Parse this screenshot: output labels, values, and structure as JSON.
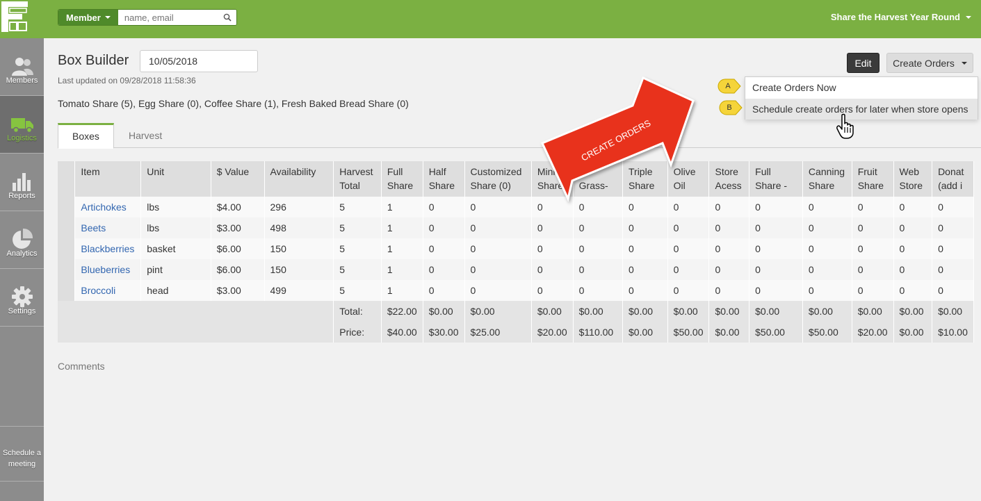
{
  "header": {
    "member_label": "Member",
    "search_placeholder": "name, email",
    "org_name": "Share the Harvest Year Round"
  },
  "sidebar": {
    "items": [
      {
        "label": "Members",
        "icon": "members-icon"
      },
      {
        "label": "Logistics",
        "icon": "truck-icon"
      },
      {
        "label": "Reports",
        "icon": "bar-chart-icon"
      },
      {
        "label": "Analytics",
        "icon": "pie-chart-icon"
      },
      {
        "label": "Settings",
        "icon": "gear-icon"
      }
    ],
    "schedule": "Schedule a meeting"
  },
  "page": {
    "title": "Box Builder",
    "date": "10/05/2018",
    "last_updated": "Last updated on 09/28/2018 11:58:36",
    "shares_text": "Tomato Share (5), Egg Share (0), Coffee Share (1), Fresh Baked Bread Share (0)",
    "edit_label": "Edit",
    "create_orders_label": "Create Orders",
    "comments_label": "Comments"
  },
  "dropdown": {
    "items": [
      "Create Orders Now",
      "Schedule create orders for later when store opens"
    ],
    "markers": [
      "A",
      "B"
    ]
  },
  "annotation": {
    "arrow_text": "CREATE ORDERS"
  },
  "tabs": [
    "Boxes",
    "Harvest"
  ],
  "table": {
    "columns": [
      "Item",
      "Unit",
      "$ Value",
      "Availability",
      "Harvest Total",
      "Full Share",
      "Half Share",
      "Customized Share (0)",
      "Mini Share",
      "Grass-",
      "Triple Share",
      "Olive Oil",
      "Store Acess",
      "Full Share -",
      "Canning Share",
      "Fruit Share",
      "Web Store",
      "Donat (add i"
    ],
    "rows": [
      [
        "Artichokes",
        "lbs",
        "$4.00",
        "296",
        "5",
        "1",
        "0",
        "0",
        "0",
        "0",
        "0",
        "0",
        "0",
        "0",
        "0",
        "0",
        "0",
        "0"
      ],
      [
        "Beets",
        "lbs",
        "$3.00",
        "498",
        "5",
        "1",
        "0",
        "0",
        "0",
        "0",
        "0",
        "0",
        "0",
        "0",
        "0",
        "0",
        "0",
        "0"
      ],
      [
        "Blackberries",
        "basket",
        "$6.00",
        "150",
        "5",
        "1",
        "0",
        "0",
        "0",
        "0",
        "0",
        "0",
        "0",
        "0",
        "0",
        "0",
        "0",
        "0"
      ],
      [
        "Blueberries",
        "pint",
        "$6.00",
        "150",
        "5",
        "1",
        "0",
        "0",
        "0",
        "0",
        "0",
        "0",
        "0",
        "0",
        "0",
        "0",
        "0",
        "0"
      ],
      [
        "Broccoli",
        "head",
        "$3.00",
        "499",
        "5",
        "1",
        "0",
        "0",
        "0",
        "0",
        "0",
        "0",
        "0",
        "0",
        "0",
        "0",
        "0",
        "0"
      ]
    ],
    "total_label": "Total:",
    "totals": [
      "$22.00",
      "$0.00",
      "$0.00",
      "$0.00",
      "$0.00",
      "$0.00",
      "$0.00",
      "$0.00",
      "$0.00",
      "$0.00",
      "$0.00",
      "$0.00",
      "$0.00"
    ],
    "price_label": "Price:",
    "prices": [
      "$40.00",
      "$30.00",
      "$25.00",
      "$20.00",
      "$110.00",
      "$0.00",
      "$50.00",
      "$0.00",
      "$50.00",
      "$50.00",
      "$20.00",
      "$0.00",
      "$10.00"
    ]
  },
  "colors": {
    "brand_green": "#7bb042",
    "link_blue": "#3266b0",
    "arrow_red": "#e8321e",
    "marker_yellow": "#f5d43a"
  }
}
